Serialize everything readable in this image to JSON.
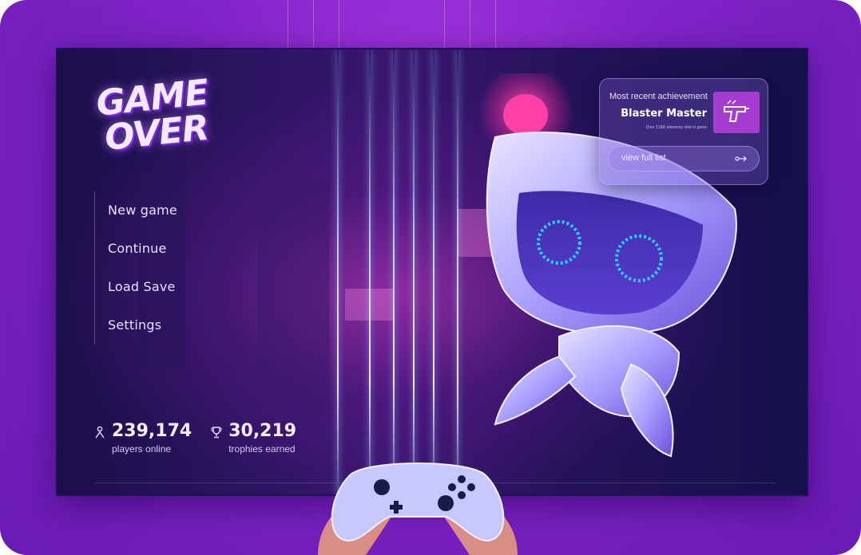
{
  "logo": {
    "line1": "GAME",
    "line2": "OVER"
  },
  "menu": {
    "items": [
      {
        "label": "New game"
      },
      {
        "label": "Continue"
      },
      {
        "label": "Load Save"
      },
      {
        "label": "Settings"
      }
    ]
  },
  "stats": {
    "players": {
      "value": "239,174",
      "label": "players online",
      "icon": "player-icon"
    },
    "trophies": {
      "value": "30,219",
      "label": "trophies earned",
      "icon": "trophy-icon"
    }
  },
  "achievement": {
    "heading": "Most recent achievement",
    "title": "Blaster Master",
    "subtitle": "Over 3,000 elements shot in game",
    "badge_icon": "blaster-icon",
    "view_label": "view full list",
    "view_icon": "arrow-right-icon"
  },
  "colors": {
    "background": "#8124c8",
    "badge": "#a43ccf",
    "robot_eye": "#2ad3ff",
    "robot_light": "#ff3fa8"
  }
}
